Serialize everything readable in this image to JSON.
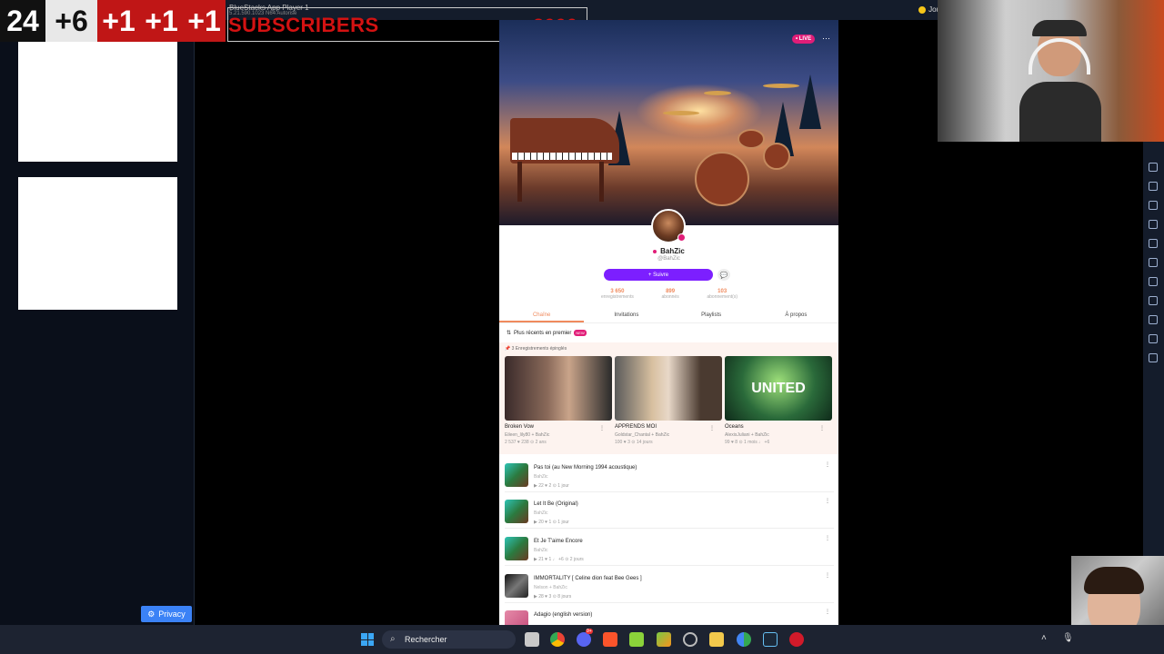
{
  "overlay": {
    "counter_total": "24",
    "counter_gain": "+6",
    "counter_plus": [
      "+1",
      "+1",
      "+1"
    ],
    "banner_text": "SUBSCRIBERS",
    "banner_goal": "2000"
  },
  "window": {
    "title": "BlueStacks App Player 1",
    "subtitle": "5.21.590.1023 N64 Autorisé",
    "right_label": "Jou"
  },
  "left_panel": {
    "privacy_label": "Privacy"
  },
  "profile": {
    "live_badge": "• LIVE",
    "name": "BahZic",
    "handle": "@BahZic",
    "follow_label": "+ Suivre",
    "stats": [
      {
        "value": "3 650",
        "label": "enregistrements"
      },
      {
        "value": "899",
        "label": "abonnés"
      },
      {
        "value": "103",
        "label": "abonnement(s)"
      }
    ],
    "tabs": [
      "Chaîne",
      "Invitations",
      "Playlists",
      "À propos"
    ],
    "sort_label": "Plus récents en premier",
    "sort_badge": "NEW",
    "pinned_label": "3 Enregistrements épinglés",
    "pinned": [
      {
        "title": "Broken Vow",
        "sub": "Eileen_lily80 + BahZic",
        "meta": "2 537  ♥ 238  ⊙ 2 ans"
      },
      {
        "title": "APPRENDS MOI",
        "sub": "Goldstar_Chantal + BahZic",
        "meta": "100  ♥ 3  ⊙ 14 jours"
      },
      {
        "title": "Oceans",
        "sub": "AlexisJuliani + BahZic",
        "meta": "99  ♥ 8  ⊙ 1 mois  ♩ +6"
      }
    ],
    "recordings": [
      {
        "title": "Pas toi (au New Morning 1994 acoustique)",
        "sub": "BahZic",
        "meta": "▶ 22  ♥ 2  ⊙ 1 jour"
      },
      {
        "title": "Let It Be (Original)",
        "sub": "BahZic",
        "meta": "▶ 20  ♥ 1  ⊙ 1 jour"
      },
      {
        "title": "Et Je T'aime Encore",
        "sub": "BahZic",
        "meta": "▶ 21  ♥ 1  ♩ +6  ⊙ 2 jours"
      },
      {
        "title": "IMMORTALITY [ Celine dion feat Bee Gees ]",
        "sub": "Nelson + BahZic",
        "meta": "▶ 28  ♥ 3  ⊙ 8 jours"
      },
      {
        "title": "Adagio (english version)",
        "sub": "",
        "meta": ""
      }
    ]
  },
  "taskbar": {
    "search_placeholder": "Rechercher",
    "discord_badge": "9+"
  },
  "colors": {
    "accent_purple": "#7c1fff",
    "accent_orange": "#f08a5d",
    "live_pink": "#e11d78",
    "overlay_red": "#c01616"
  }
}
